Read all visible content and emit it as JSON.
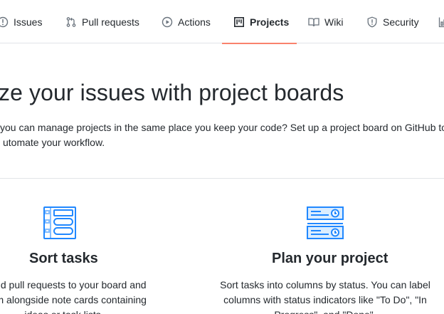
{
  "tabs": [
    {
      "label": "Issues",
      "icon": "issue-opened-icon"
    },
    {
      "label": "Pull requests",
      "icon": "git-pull-request-icon"
    },
    {
      "label": "Actions",
      "icon": "play-icon"
    },
    {
      "label": "Projects",
      "icon": "project-icon",
      "selected": true
    },
    {
      "label": "Wiki",
      "icon": "book-icon"
    },
    {
      "label": "Security",
      "icon": "shield-icon"
    },
    {
      "label": "",
      "icon": "graph-icon"
    }
  ],
  "colors": {
    "selected_tab_underline": "#f9826c",
    "icon_blue": "#2188ff",
    "text": "#24292e",
    "icon_gray": "#6a737d",
    "divider": "#e1e4e8"
  },
  "blankslate": {
    "headline": "ze your issues with project boards",
    "lead_line1": "you can manage projects in the same place you keep your code? Set up a project board on GitHub to",
    "lead_line2": "utomate your workflow."
  },
  "features": [
    {
      "icon": "kanban-board-icon",
      "title": "Sort tasks",
      "desc_lines": [
        "s and pull requests to your board and",
        "them alongside note cards containing",
        "ideas or task lists."
      ]
    },
    {
      "icon": "status-columns-icon",
      "title": "Plan your project",
      "desc_lines": [
        "Sort tasks into columns by status. You can label",
        "columns with status indicators like \"To Do\", \"In",
        "Progress\", and \"Done\"."
      ]
    }
  ]
}
